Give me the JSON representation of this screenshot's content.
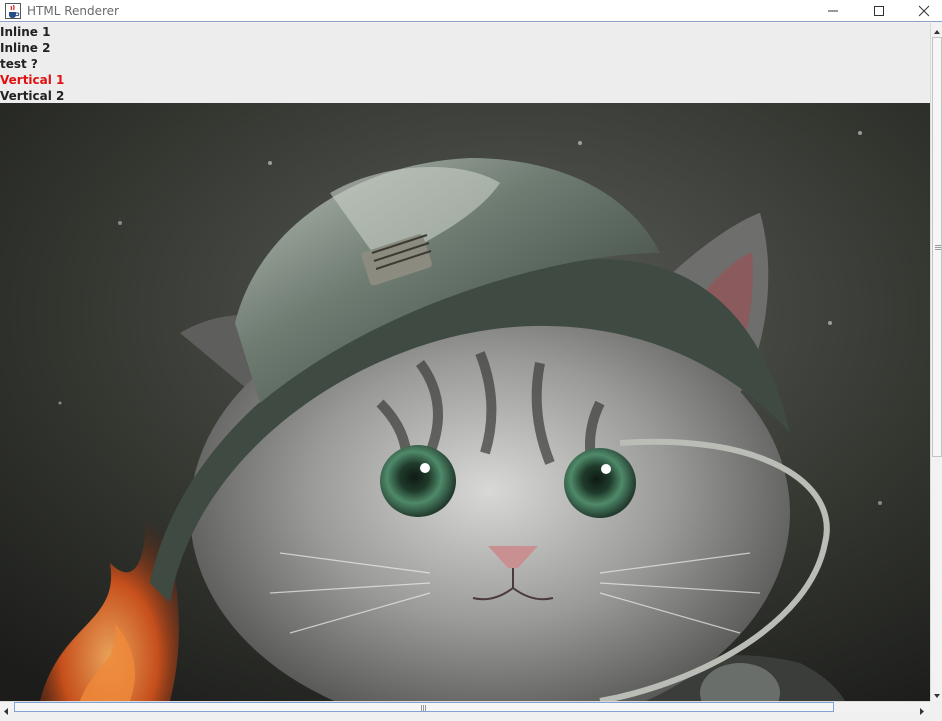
{
  "window": {
    "title": "HTML Renderer",
    "icon": "java-cup-icon",
    "controls": [
      "minimize-icon",
      "maximize-icon",
      "close-icon"
    ]
  },
  "content": {
    "lines": [
      {
        "text": "Inline 1",
        "color": "#222222"
      },
      {
        "text": "Inline 2",
        "color": "#222222"
      },
      {
        "text": "test ?",
        "color": "#222222"
      },
      {
        "text": "Vertical 1",
        "color": "#e01010"
      },
      {
        "text": "Vertical 2",
        "color": "#222222"
      }
    ],
    "image": {
      "subject": "kitten-in-firefighter-helmet"
    }
  },
  "colors": {
    "title_text": "#6b6b6b",
    "highlight_red": "#e01010",
    "scrollbar_accent": "#7fa3d4"
  }
}
